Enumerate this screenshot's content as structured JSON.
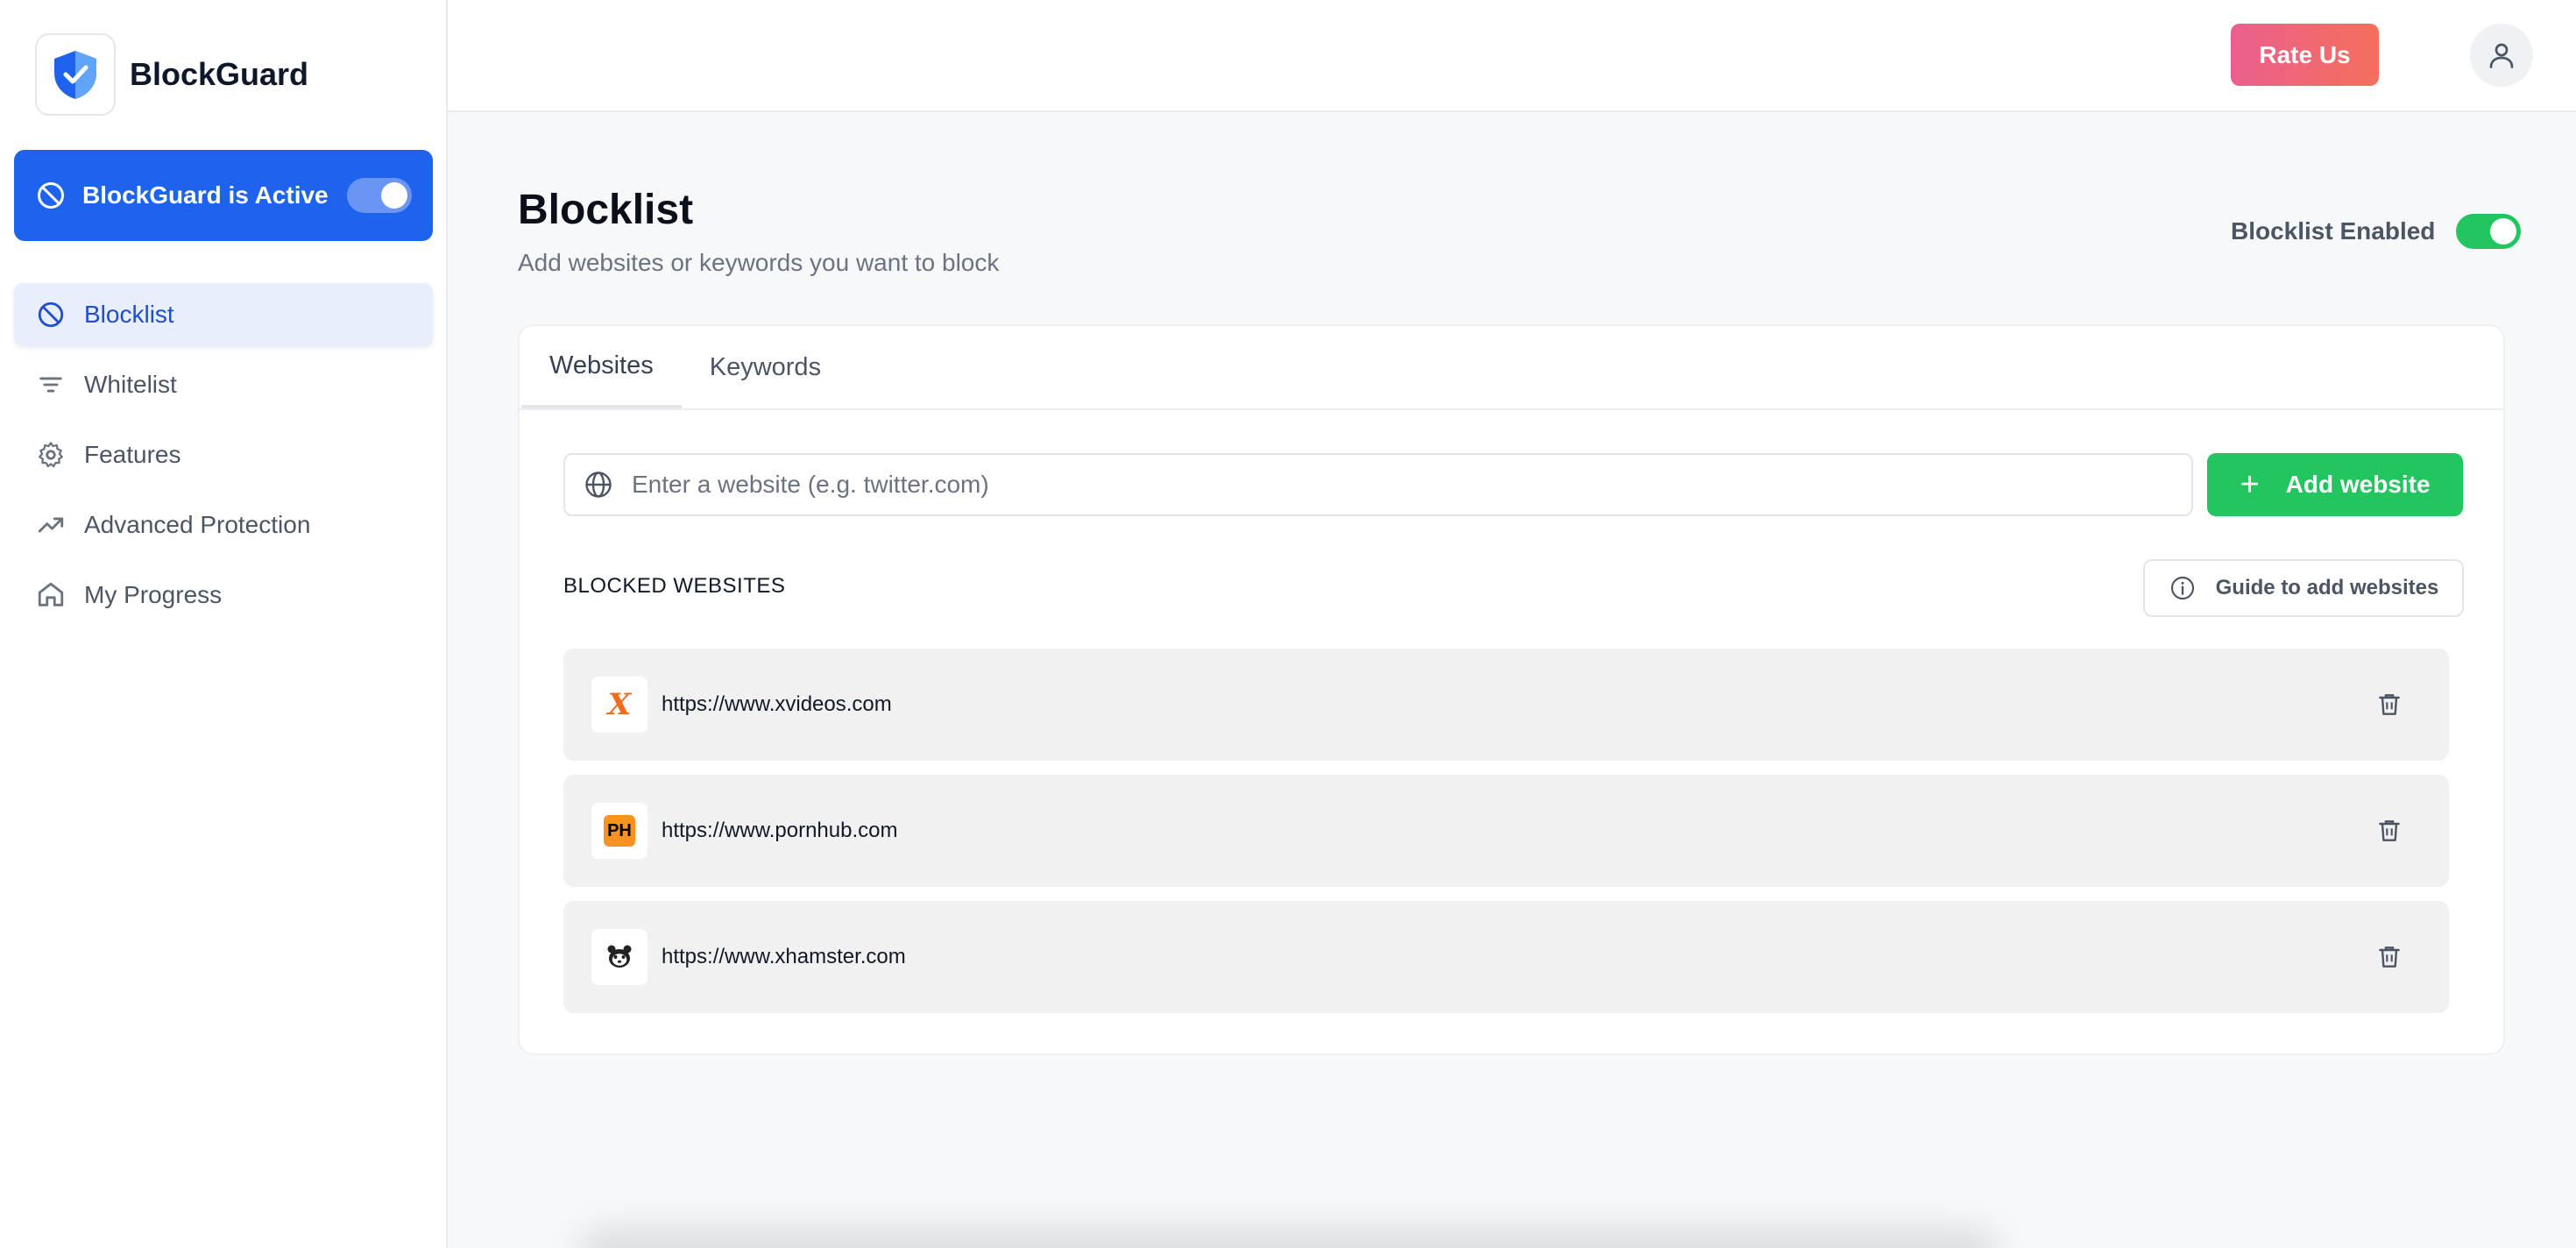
{
  "brand": {
    "name": "BlockGuard",
    "logo_icon": "shield-icon"
  },
  "status_card": {
    "label": "BlockGuard is Active",
    "icon": "ban-icon",
    "enabled": true
  },
  "sidebar": {
    "items": [
      {
        "label": "Blocklist",
        "icon": "ban-icon",
        "active": true
      },
      {
        "label": "Whitelist",
        "icon": "filter-icon",
        "active": false
      },
      {
        "label": "Features",
        "icon": "gear-icon",
        "active": false
      },
      {
        "label": "Advanced Protection",
        "icon": "trending-up-icon",
        "active": false
      },
      {
        "label": "My Progress",
        "icon": "home-icon",
        "active": false
      }
    ]
  },
  "topbar": {
    "rate_label": "Rate Us",
    "avatar_icon": "user-icon"
  },
  "main": {
    "title": "Blocklist",
    "subtitle": "Add websites or keywords you want to block",
    "enabled_label": "Blocklist Enabled",
    "enabled": true,
    "tabs": [
      {
        "label": "Websites",
        "active": true
      },
      {
        "label": "Keywords",
        "active": false
      }
    ],
    "input": {
      "placeholder": "Enter a website (e.g. twitter.com)",
      "value": ""
    },
    "add_button_label": "Add website",
    "section_label": "BLOCKED WEBSITES",
    "guide_label": "Guide to add websites",
    "sites": [
      {
        "url": "https://www.xvideos.com",
        "favicon": "X"
      },
      {
        "url": "https://www.pornhub.com",
        "favicon": "PH"
      },
      {
        "url": "https://www.xhamster.com",
        "favicon": "hamster-icon"
      }
    ]
  },
  "colors": {
    "accent_blue": "#1d63ed",
    "green": "#22c55e",
    "rate_gradient_start": "#eb5f8e",
    "rate_gradient_end": "#f56f5c"
  }
}
